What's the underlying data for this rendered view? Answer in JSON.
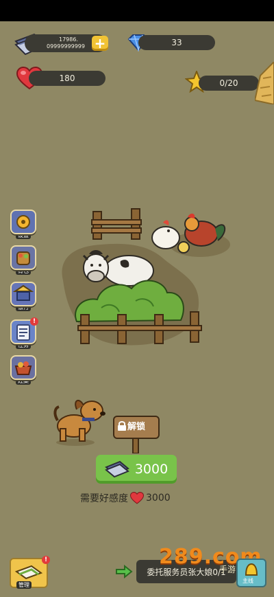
{
  "resources": {
    "cash_top": "17986.",
    "cash_bottom": "09999999999",
    "gems": "33",
    "hearts": "180",
    "stars": "0/20"
  },
  "side_menu": [
    {
      "label": "设置",
      "icon": "gear-icon"
    },
    {
      "label": "背包",
      "icon": "backpack-icon"
    },
    {
      "label": "银行",
      "icon": "bank-icon"
    },
    {
      "label": "任务",
      "icon": "quest-icon",
      "badge": "!"
    },
    {
      "label": "灶集",
      "icon": "market-icon"
    }
  ],
  "unlock": {
    "sign_label": "解锁",
    "price": "3000",
    "need_text": "需要好感度",
    "need_value": "3000"
  },
  "bottom": {
    "left_button_label": "管理",
    "left_badge": "!",
    "task_text": "委托服务员张大娘0/1",
    "mainline_label": "主线"
  },
  "watermark": {
    "main": "289.com",
    "sub": "手游网"
  },
  "colors": {
    "background": "#8f8864",
    "button_green": "#79c34a",
    "pill_dark": "#3b3a33",
    "heart_red": "#e0383e"
  }
}
